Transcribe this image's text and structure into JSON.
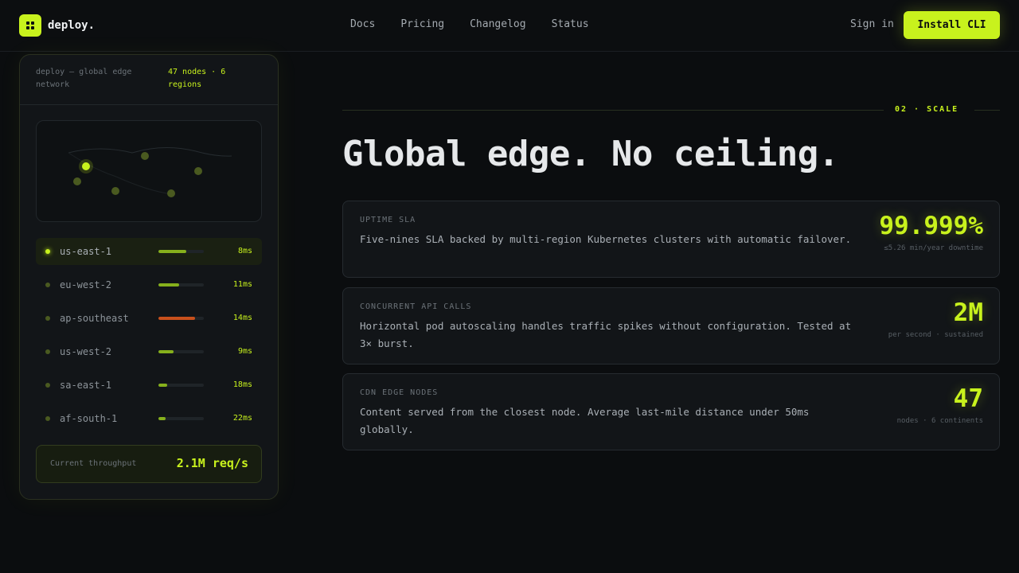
{
  "brand": {
    "name": "deploy."
  },
  "nav": {
    "links": [
      "Docs",
      "Pricing",
      "Changelog",
      "Status"
    ],
    "signin": "Sign in",
    "cta": "Install CLI"
  },
  "panel": {
    "title": "deploy — global edge network",
    "summary": "47 nodes · 6 regions",
    "regions": [
      {
        "name": "us-east-1",
        "latency": "8ms",
        "load": 0.62,
        "color": "#86b01c",
        "active": true
      },
      {
        "name": "eu-west-2",
        "latency": "11ms",
        "load": 0.45,
        "color": "#86b01c",
        "active": false
      },
      {
        "name": "ap-southeast",
        "latency": "14ms",
        "load": 0.8,
        "color": "#c8501c",
        "active": false
      },
      {
        "name": "us-west-2",
        "latency": "9ms",
        "load": 0.33,
        "color": "#86b01c",
        "active": false
      },
      {
        "name": "sa-east-1",
        "latency": "18ms",
        "load": 0.2,
        "color": "#86b01c",
        "active": false
      },
      {
        "name": "af-south-1",
        "latency": "22ms",
        "load": 0.15,
        "color": "#86b01c",
        "active": false
      }
    ],
    "throughput_label": "Current throughput",
    "throughput_value": "2.1M req/s"
  },
  "section": {
    "eyebrow": "02 · SCALE",
    "headline": "Global edge. No ceiling."
  },
  "cards": [
    {
      "label": "UPTIME SLA",
      "text": "Five-nines SLA backed by multi-region Kubernetes clusters with automatic failover.",
      "value": "99.999%",
      "sub": "≤5.26 min/year downtime"
    },
    {
      "label": "CONCURRENT API CALLS",
      "text": "Horizontal pod autoscaling handles traffic spikes without configuration. Tested at 3× burst.",
      "value": "2M",
      "sub": "per second · sustained"
    },
    {
      "label": "CDN EDGE NODES",
      "text": "Content served from the closest node. Average last-mile distance under 50ms globally.",
      "value": "47",
      "sub": "nodes · 6 continents"
    }
  ],
  "colors": {
    "accent": "#c8f21d",
    "background": "#0b0d0f",
    "warning": "#c8501c"
  }
}
